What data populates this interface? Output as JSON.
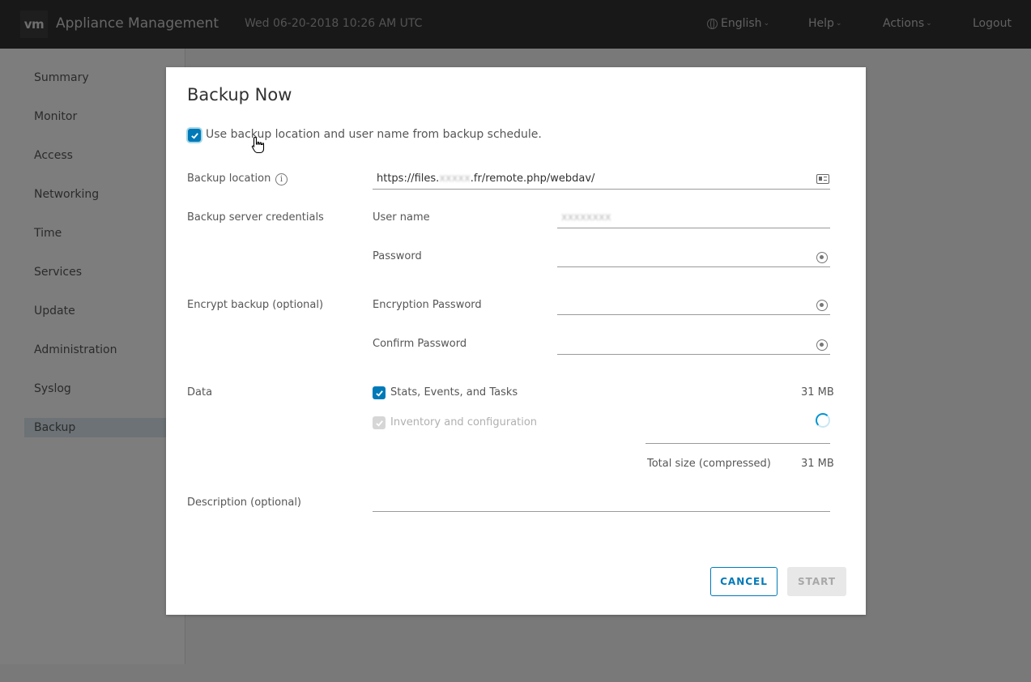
{
  "header": {
    "logo": "vm",
    "app_title": "Appliance Management",
    "datetime": "Wed 06-20-2018 10:26 AM UTC",
    "language": "English",
    "help": "Help",
    "actions": "Actions",
    "logout": "Logout"
  },
  "sidebar": {
    "items": [
      "Summary",
      "Monitor",
      "Access",
      "Networking",
      "Time",
      "Services",
      "Update",
      "Administration",
      "Syslog",
      "Backup"
    ],
    "active": "Backup"
  },
  "dialog": {
    "title": "Backup Now",
    "use_schedule_label": "Use backup location and user name from backup schedule.",
    "use_schedule_checked": true,
    "backup_location_label": "Backup location",
    "backup_location_prefix": "https://files.",
    "backup_location_redacted": "xxxxx",
    "backup_location_suffix": ".fr/remote.php/webdav/",
    "credentials_label": "Backup server credentials",
    "username_label": "User name",
    "username_value_redacted": "xxxxxxxx",
    "password_label": "Password",
    "encrypt_label": "Encrypt backup (optional)",
    "encryption_password_label": "Encryption Password",
    "confirm_password_label": "Confirm Password",
    "data_label": "Data",
    "stats_label": "Stats, Events, and Tasks",
    "stats_checked": true,
    "stats_size": "31 MB",
    "inventory_label": "Inventory and configuration",
    "inventory_checked": true,
    "inventory_disabled": true,
    "total_label": "Total size (compressed)",
    "total_size": "31 MB",
    "description_label": "Description (optional)",
    "cancel_label": "CANCEL",
    "start_label": "START"
  }
}
